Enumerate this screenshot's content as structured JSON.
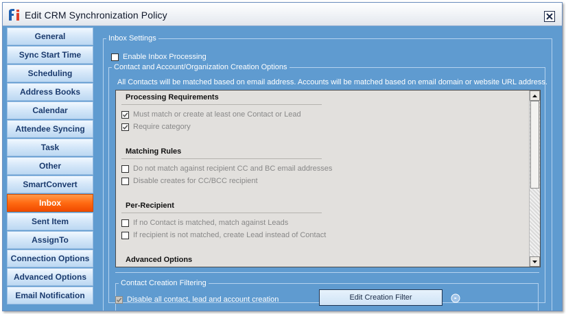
{
  "window": {
    "title": "Edit CRM Synchronization Policy"
  },
  "sidebar": {
    "items": [
      {
        "label": "General"
      },
      {
        "label": "Sync Start Time"
      },
      {
        "label": "Scheduling"
      },
      {
        "label": "Address Books"
      },
      {
        "label": "Calendar"
      },
      {
        "label": "Attendee Syncing"
      },
      {
        "label": "Task"
      },
      {
        "label": "Other"
      },
      {
        "label": "SmartConvert"
      },
      {
        "label": "Inbox",
        "active": true
      },
      {
        "label": "Sent Item"
      },
      {
        "label": "AssignTo"
      },
      {
        "label": "Connection Options"
      },
      {
        "label": "Advanced Options"
      },
      {
        "label": "Email Notification"
      }
    ]
  },
  "inbox": {
    "legend": "Inbox Settings",
    "enable_label": "Enable Inbox Processing",
    "enable_checked": false,
    "contact_legend": "Contact and Account/Organization Creation Options",
    "match_text": "All Contacts will be matched based on email address.  Accounts will be matched based on email domain or website URL address.",
    "sections": [
      {
        "title": "Processing Requirements",
        "options": [
          {
            "label": "Must match or create at least one Contact or Lead",
            "checked": true
          },
          {
            "label": "Require category",
            "checked": true
          }
        ]
      },
      {
        "title": "Matching Rules",
        "options": [
          {
            "label": "Do not match against recipient CC and BC email addresses",
            "checked": false
          },
          {
            "label": "Disable creates  for CC/BCC recipient",
            "checked": false
          }
        ]
      },
      {
        "title": "Per-Recipient",
        "options": [
          {
            "label": "If no Contact is matched, match against Leads",
            "checked": false
          },
          {
            "label": "If recipient is not matched, create Lead instead of Contact",
            "checked": false
          }
        ]
      },
      {
        "title": "Advanced Options",
        "options": []
      }
    ],
    "filter_legend": "Contact Creation Filtering",
    "disable_all_label": "Disable all contact, lead and account creation",
    "disable_all_checked": true,
    "filter_button_label": "Edit Creation Filter"
  },
  "colors": {
    "panel": "#5f9bd0",
    "active_tab": "#ff6a12"
  }
}
